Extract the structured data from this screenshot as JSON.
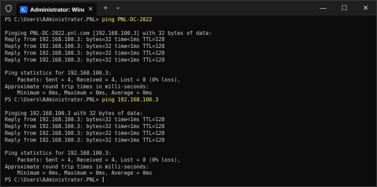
{
  "window": {
    "tab_title": "Administrator: Windows Powe",
    "tab_close": "✕",
    "new_tab": "+",
    "dropdown": "⌄",
    "minimize": "—",
    "maximize": "☐",
    "close": "✕"
  },
  "terminal": {
    "lines": [
      {
        "prompt": "PS C:\\Users\\Administrator.PNL> ",
        "cmd": "ping PNL-DC-2022"
      },
      {
        "text": ""
      },
      {
        "text": "Pinging PNL-DC-2022.pnl.com [192.168.100.3] with 32 bytes of data:"
      },
      {
        "text": "Reply from 192.168.100.3: bytes=32 time<1ms TTL=128"
      },
      {
        "text": "Reply from 192.168.100.3: bytes=32 time<1ms TTL=128"
      },
      {
        "text": "Reply from 192.168.100.3: bytes=32 time<1ms TTL=128"
      },
      {
        "text": "Reply from 192.168.100.3: bytes=32 time<1ms TTL=128"
      },
      {
        "text": ""
      },
      {
        "text": "Ping statistics for 192.168.100.3:"
      },
      {
        "text": "    Packets: Sent = 4, Received = 4, Lost = 0 (0% loss),"
      },
      {
        "text": "Approximate round trip times in milli-seconds:"
      },
      {
        "text": "    Minimum = 0ms, Maximum = 0ms, Average = 0ms"
      },
      {
        "prompt": "PS C:\\Users\\Administrator.PNL> ",
        "cmd": "ping 192.168.100.3"
      },
      {
        "text": ""
      },
      {
        "text": "Pinging 192.168.100.3 with 32 bytes of data:"
      },
      {
        "text": "Reply from 192.168.100.3: bytes=32 time<1ms TTL=128"
      },
      {
        "text": "Reply from 192.168.100.3: bytes=32 time<1ms TTL=128"
      },
      {
        "text": "Reply from 192.168.100.3: bytes=32 time<1ms TTL=128"
      },
      {
        "text": "Reply from 192.168.100.3: bytes=32 time<1ms TTL=128"
      },
      {
        "text": ""
      },
      {
        "text": "Ping statistics for 192.168.100.3:"
      },
      {
        "text": "    Packets: Sent = 4, Received = 4, Lost = 0 (0% loss),"
      },
      {
        "text": "Approximate round trip times in milli-seconds:"
      },
      {
        "text": "    Minimum = 0ms, Maximum = 0ms, Average = 0ms"
      },
      {
        "prompt": "PS C:\\Users\\Administrator.PNL> ",
        "cmd": "",
        "cursor": true
      }
    ]
  }
}
